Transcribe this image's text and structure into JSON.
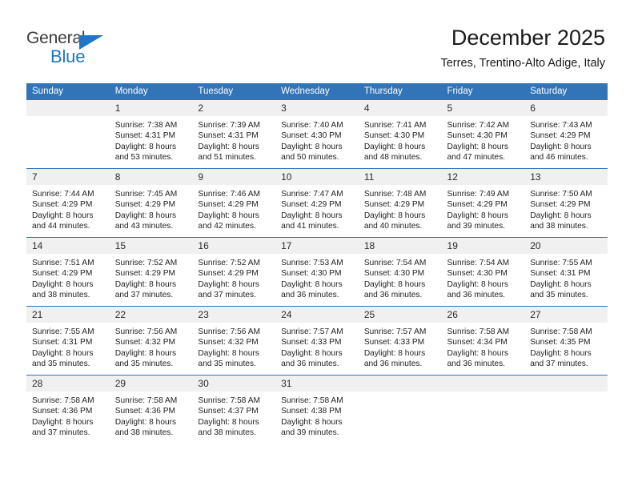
{
  "brand": {
    "name_part1": "General",
    "name_part2": "Blue",
    "triangle_color": "#1f76c4",
    "text_color": "#3b3b3b"
  },
  "header": {
    "title": "December 2025",
    "subtitle": "Terres, Trentino-Alto Adige, Italy"
  },
  "theme": {
    "header_row_bg": "#3174b8",
    "daynum_bg": "#f0f0f0",
    "separator": "#3174b8"
  },
  "weekdays": [
    "Sunday",
    "Monday",
    "Tuesday",
    "Wednesday",
    "Thursday",
    "Friday",
    "Saturday"
  ],
  "weeks": [
    [
      {
        "day": "",
        "lines": []
      },
      {
        "day": "1",
        "lines": [
          "Sunrise: 7:38 AM",
          "Sunset: 4:31 PM",
          "Daylight: 8 hours",
          "and 53 minutes."
        ]
      },
      {
        "day": "2",
        "lines": [
          "Sunrise: 7:39 AM",
          "Sunset: 4:31 PM",
          "Daylight: 8 hours",
          "and 51 minutes."
        ]
      },
      {
        "day": "3",
        "lines": [
          "Sunrise: 7:40 AM",
          "Sunset: 4:30 PM",
          "Daylight: 8 hours",
          "and 50 minutes."
        ]
      },
      {
        "day": "4",
        "lines": [
          "Sunrise: 7:41 AM",
          "Sunset: 4:30 PM",
          "Daylight: 8 hours",
          "and 48 minutes."
        ]
      },
      {
        "day": "5",
        "lines": [
          "Sunrise: 7:42 AM",
          "Sunset: 4:30 PM",
          "Daylight: 8 hours",
          "and 47 minutes."
        ]
      },
      {
        "day": "6",
        "lines": [
          "Sunrise: 7:43 AM",
          "Sunset: 4:29 PM",
          "Daylight: 8 hours",
          "and 46 minutes."
        ]
      }
    ],
    [
      {
        "day": "7",
        "lines": [
          "Sunrise: 7:44 AM",
          "Sunset: 4:29 PM",
          "Daylight: 8 hours",
          "and 44 minutes."
        ]
      },
      {
        "day": "8",
        "lines": [
          "Sunrise: 7:45 AM",
          "Sunset: 4:29 PM",
          "Daylight: 8 hours",
          "and 43 minutes."
        ]
      },
      {
        "day": "9",
        "lines": [
          "Sunrise: 7:46 AM",
          "Sunset: 4:29 PM",
          "Daylight: 8 hours",
          "and 42 minutes."
        ]
      },
      {
        "day": "10",
        "lines": [
          "Sunrise: 7:47 AM",
          "Sunset: 4:29 PM",
          "Daylight: 8 hours",
          "and 41 minutes."
        ]
      },
      {
        "day": "11",
        "lines": [
          "Sunrise: 7:48 AM",
          "Sunset: 4:29 PM",
          "Daylight: 8 hours",
          "and 40 minutes."
        ]
      },
      {
        "day": "12",
        "lines": [
          "Sunrise: 7:49 AM",
          "Sunset: 4:29 PM",
          "Daylight: 8 hours",
          "and 39 minutes."
        ]
      },
      {
        "day": "13",
        "lines": [
          "Sunrise: 7:50 AM",
          "Sunset: 4:29 PM",
          "Daylight: 8 hours",
          "and 38 minutes."
        ]
      }
    ],
    [
      {
        "day": "14",
        "lines": [
          "Sunrise: 7:51 AM",
          "Sunset: 4:29 PM",
          "Daylight: 8 hours",
          "and 38 minutes."
        ]
      },
      {
        "day": "15",
        "lines": [
          "Sunrise: 7:52 AM",
          "Sunset: 4:29 PM",
          "Daylight: 8 hours",
          "and 37 minutes."
        ]
      },
      {
        "day": "16",
        "lines": [
          "Sunrise: 7:52 AM",
          "Sunset: 4:29 PM",
          "Daylight: 8 hours",
          "and 37 minutes."
        ]
      },
      {
        "day": "17",
        "lines": [
          "Sunrise: 7:53 AM",
          "Sunset: 4:30 PM",
          "Daylight: 8 hours",
          "and 36 minutes."
        ]
      },
      {
        "day": "18",
        "lines": [
          "Sunrise: 7:54 AM",
          "Sunset: 4:30 PM",
          "Daylight: 8 hours",
          "and 36 minutes."
        ]
      },
      {
        "day": "19",
        "lines": [
          "Sunrise: 7:54 AM",
          "Sunset: 4:30 PM",
          "Daylight: 8 hours",
          "and 36 minutes."
        ]
      },
      {
        "day": "20",
        "lines": [
          "Sunrise: 7:55 AM",
          "Sunset: 4:31 PM",
          "Daylight: 8 hours",
          "and 35 minutes."
        ]
      }
    ],
    [
      {
        "day": "21",
        "lines": [
          "Sunrise: 7:55 AM",
          "Sunset: 4:31 PM",
          "Daylight: 8 hours",
          "and 35 minutes."
        ]
      },
      {
        "day": "22",
        "lines": [
          "Sunrise: 7:56 AM",
          "Sunset: 4:32 PM",
          "Daylight: 8 hours",
          "and 35 minutes."
        ]
      },
      {
        "day": "23",
        "lines": [
          "Sunrise: 7:56 AM",
          "Sunset: 4:32 PM",
          "Daylight: 8 hours",
          "and 35 minutes."
        ]
      },
      {
        "day": "24",
        "lines": [
          "Sunrise: 7:57 AM",
          "Sunset: 4:33 PM",
          "Daylight: 8 hours",
          "and 36 minutes."
        ]
      },
      {
        "day": "25",
        "lines": [
          "Sunrise: 7:57 AM",
          "Sunset: 4:33 PM",
          "Daylight: 8 hours",
          "and 36 minutes."
        ]
      },
      {
        "day": "26",
        "lines": [
          "Sunrise: 7:58 AM",
          "Sunset: 4:34 PM",
          "Daylight: 8 hours",
          "and 36 minutes."
        ]
      },
      {
        "day": "27",
        "lines": [
          "Sunrise: 7:58 AM",
          "Sunset: 4:35 PM",
          "Daylight: 8 hours",
          "and 37 minutes."
        ]
      }
    ],
    [
      {
        "day": "28",
        "lines": [
          "Sunrise: 7:58 AM",
          "Sunset: 4:36 PM",
          "Daylight: 8 hours",
          "and 37 minutes."
        ]
      },
      {
        "day": "29",
        "lines": [
          "Sunrise: 7:58 AM",
          "Sunset: 4:36 PM",
          "Daylight: 8 hours",
          "and 38 minutes."
        ]
      },
      {
        "day": "30",
        "lines": [
          "Sunrise: 7:58 AM",
          "Sunset: 4:37 PM",
          "Daylight: 8 hours",
          "and 38 minutes."
        ]
      },
      {
        "day": "31",
        "lines": [
          "Sunrise: 7:58 AM",
          "Sunset: 4:38 PM",
          "Daylight: 8 hours",
          "and 39 minutes."
        ]
      },
      {
        "day": "",
        "lines": []
      },
      {
        "day": "",
        "lines": []
      },
      {
        "day": "",
        "lines": []
      }
    ]
  ]
}
